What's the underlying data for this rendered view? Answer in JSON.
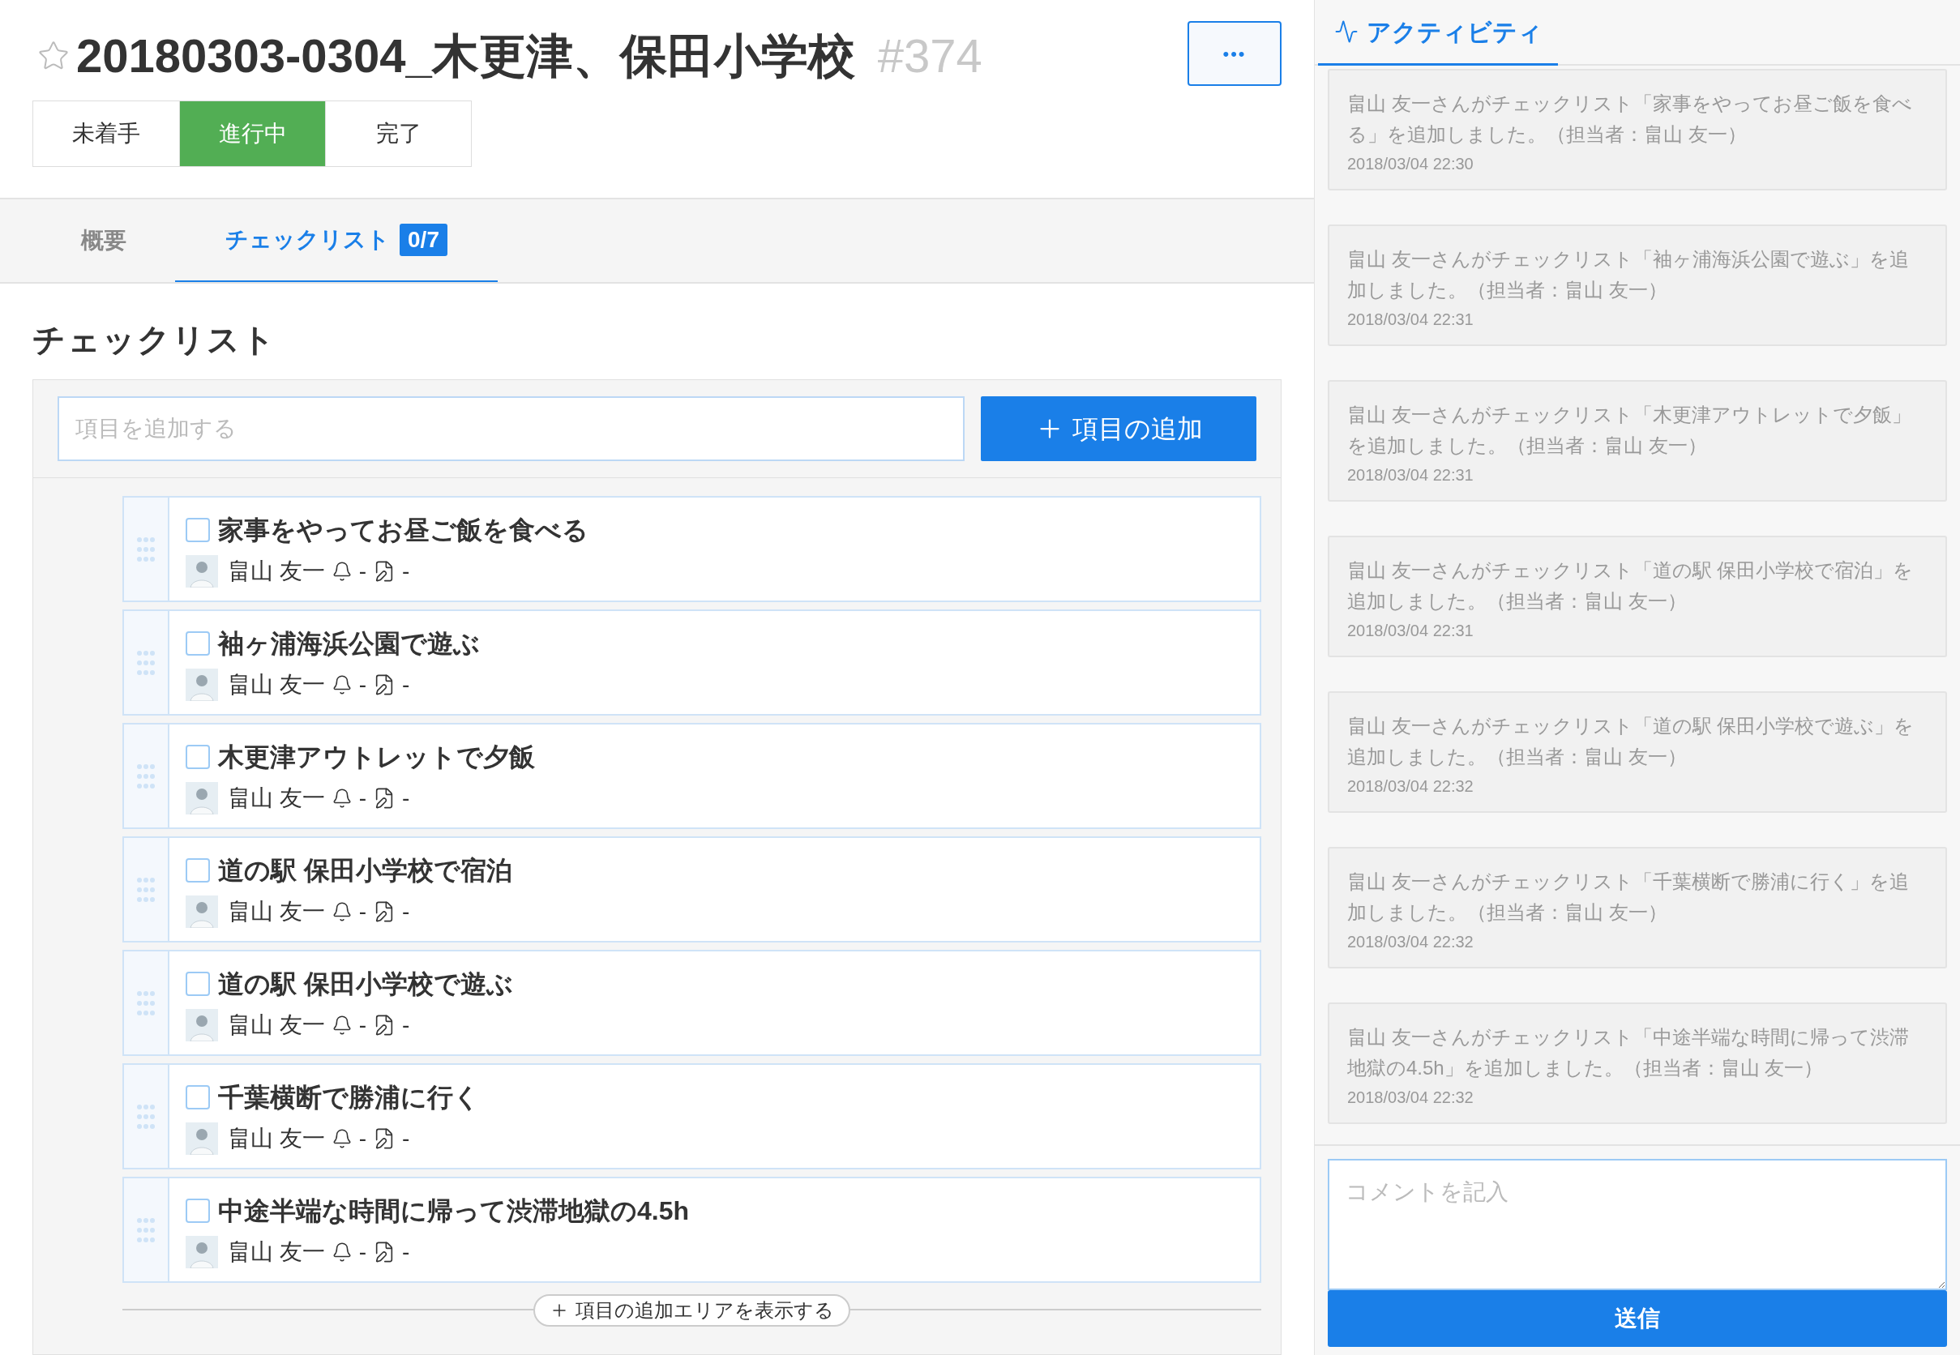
{
  "header": {
    "title": "20180303-0304_木更津、保田小学校",
    "number": "#374",
    "starred": false,
    "more_button": "•••"
  },
  "status_buttons": [
    {
      "label": "未着手",
      "selected": false
    },
    {
      "label": "進行中",
      "selected": true
    },
    {
      "label": "完了",
      "selected": false
    }
  ],
  "tabs": [
    {
      "label": "概要",
      "selected": false
    },
    {
      "label": "チェックリスト",
      "badge": "0/7",
      "selected": true
    }
  ],
  "checklist": {
    "heading": "チェックリスト",
    "input": {
      "placeholder": "項目を追加する"
    },
    "add_button": "項目の追加",
    "items": [
      {
        "title": "家事をやってお昼ご飯を食べる",
        "checked": false,
        "assignee": "畠山 友一",
        "reminder": "-",
        "note": "-"
      },
      {
        "title": "袖ヶ浦海浜公園で遊ぶ",
        "checked": false,
        "assignee": "畠山 友一",
        "reminder": "-",
        "note": "-"
      },
      {
        "title": "木更津アウトレットで夕飯",
        "checked": false,
        "assignee": "畠山 友一",
        "reminder": "-",
        "note": "-"
      },
      {
        "title": "道の駅 保田小学校で宿泊",
        "checked": false,
        "assignee": "畠山 友一",
        "reminder": "-",
        "note": "-"
      },
      {
        "title": "道の駅 保田小学校で遊ぶ",
        "checked": false,
        "assignee": "畠山 友一",
        "reminder": "-",
        "note": "-"
      },
      {
        "title": "千葉横断で勝浦に行く",
        "checked": false,
        "assignee": "畠山 友一",
        "reminder": "-",
        "note": "-"
      },
      {
        "title": "中途半端な時間に帰って渋滞地獄の4.5h",
        "checked": false,
        "assignee": "畠山 友一",
        "reminder": "-",
        "note": "-"
      }
    ],
    "show_add_area": "項目の追加エリアを表示する"
  },
  "activity": {
    "tab": "アクティビティ",
    "entries": [
      {
        "text": "畠山 友一さんがチェックリスト「家事をやってお昼ご飯を食べる」を追加しました。（担当者：畠山 友一）",
        "time": "2018/03/04 22:30"
      },
      {
        "text": "畠山 友一さんがチェックリスト「袖ヶ浦海浜公園で遊ぶ」を追加しました。（担当者：畠山 友一）",
        "time": "2018/03/04 22:31"
      },
      {
        "text": "畠山 友一さんがチェックリスト「木更津アウトレットで夕飯」を追加しました。（担当者：畠山 友一）",
        "time": "2018/03/04 22:31"
      },
      {
        "text": "畠山 友一さんがチェックリスト「道の駅 保田小学校で宿泊」を追加しました。（担当者：畠山 友一）",
        "time": "2018/03/04 22:31"
      },
      {
        "text": "畠山 友一さんがチェックリスト「道の駅 保田小学校で遊ぶ」を追加しました。（担当者：畠山 友一）",
        "time": "2018/03/04 22:32"
      },
      {
        "text": "畠山 友一さんがチェックリスト「千葉横断で勝浦に行く」を追加しました。（担当者：畠山 友一）",
        "time": "2018/03/04 22:32"
      },
      {
        "text": "畠山 友一さんがチェックリスト「中途半端な時間に帰って渋滞地獄の4.5h」を追加しました。（担当者：畠山 友一）",
        "time": "2018/03/04 22:32"
      }
    ],
    "comment": {
      "placeholder": "コメントを記入"
    },
    "send_button": "送信"
  }
}
